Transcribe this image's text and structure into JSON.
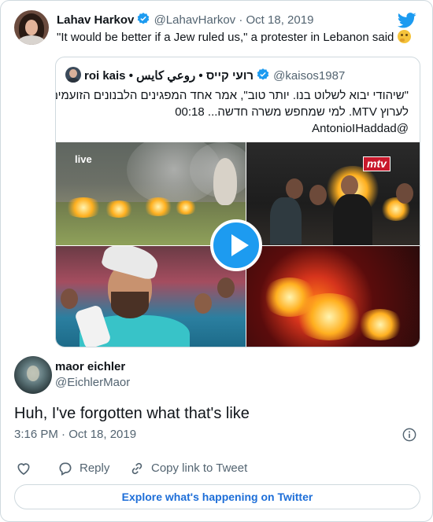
{
  "parent_tweet": {
    "name": "Lahav Harkov",
    "handle": "@LahavHarkov",
    "separator": "·",
    "date": "Oct 18, 2019",
    "text": "\"It would be better if a Jew ruled us,\" a protester in Lebanon said",
    "emoji": "thinking-face-emoji"
  },
  "quoted_tweet": {
    "name": "roi kais • רועי קייס • روعي كايس",
    "handle": "@kaisos1987",
    "text_lines": [
      "\"שיהודי יבוא לשלוט בנו. יותר טוב\", אמר אחד המפגינים הלבנונים הזועמים",
      "לערוץ MTV. למי שמחפש משרה חדשה... 00:18",
      "@AntonioIHaddad"
    ],
    "media": {
      "panel_logos": [
        "live",
        "mtv"
      ]
    }
  },
  "reply_tweet": {
    "name": "maor eichler",
    "handle": "@EichlerMaor",
    "text": "Huh, I've forgotten what that's like",
    "timestamp": "3:16 PM · Oct 18, 2019"
  },
  "actions": {
    "like_label": "",
    "reply_label": "Reply",
    "copy_label": "Copy link to Tweet"
  },
  "explore_label": "Explore what's happening on Twitter",
  "colors": {
    "accent": "#1d9bf0",
    "text": "#0f1419",
    "muted": "#536471",
    "border": "#cfd9de"
  }
}
